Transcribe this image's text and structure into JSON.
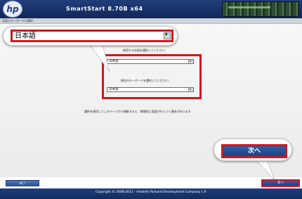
{
  "header": {
    "logo_text": "hp",
    "app_title": "SmartStart 8.70B x64"
  },
  "section": {
    "title": "言語とキーボードの選択"
  },
  "language": {
    "label": "使用する言語を選択してください：",
    "selected": "日本語"
  },
  "keyboard": {
    "label": "現在のキーボードを選択してください：",
    "selected": "日本語"
  },
  "notice": "選択を適用してこのページから移動すると、瞬間的に画面がちらつく場合があります",
  "zoom": {
    "language_selected": "日本語",
    "next_label": "次へ"
  },
  "buttons": {
    "exit_label": "終了",
    "next_label": "次へ"
  },
  "footer": {
    "copyright": "Copyright © 2008-2011 - Hewlett Packard Development Company L.P."
  },
  "colors": {
    "header_blue": "#1b3770",
    "highlight_red": "#d2161e",
    "button_blue": "#2d5fae"
  }
}
